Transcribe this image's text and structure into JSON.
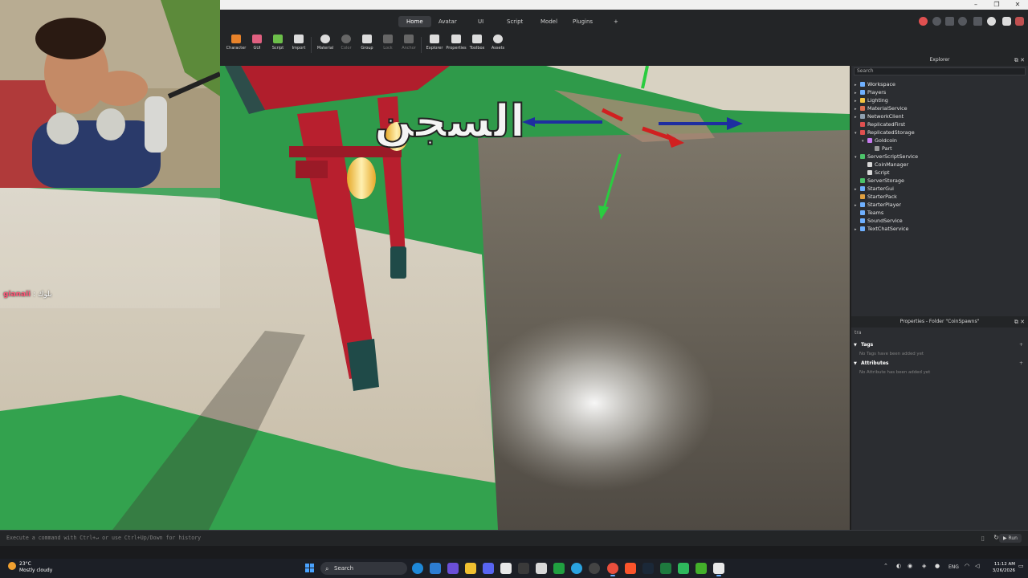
{
  "window": {
    "controls": [
      "–",
      "❐",
      "✕"
    ]
  },
  "ribbon": {
    "tabs": [
      "Home",
      "Avatar",
      "UI",
      "Script",
      "Model",
      "Plugins"
    ],
    "active_tab": "Home",
    "add_tab": "+"
  },
  "toolbar": {
    "tools": [
      "Character",
      "GUI",
      "Script",
      "Import",
      "Material",
      "Color",
      "Group",
      "Lock",
      "Anchor",
      "Explorer",
      "Properties",
      "Toolbox",
      "Assets"
    ],
    "disabled": [
      "Color",
      "Lock",
      "Anchor"
    ]
  },
  "viewport": {
    "sign_text": "السجن",
    "chat_username": "gianali",
    "chat_message": ": بلوك"
  },
  "explorer": {
    "title": "Explorer",
    "search_placeholder": "Search",
    "items": [
      {
        "label": "Workspace",
        "depth": 0,
        "arrow": "▸",
        "icon_color": "#6fb0ff"
      },
      {
        "label": "Players",
        "depth": 0,
        "arrow": "▸",
        "icon_color": "#6fb0ff"
      },
      {
        "label": "Lighting",
        "depth": 0,
        "arrow": "▸",
        "icon_color": "#f5c542"
      },
      {
        "label": "MaterialService",
        "depth": 0,
        "arrow": "▸",
        "icon_color": "#e07050"
      },
      {
        "label": "NetworkClient",
        "depth": 0,
        "arrow": "▸",
        "icon_color": "#8fa0b0"
      },
      {
        "label": "ReplicatedFirst",
        "depth": 0,
        "arrow": "",
        "icon_color": "#e05050"
      },
      {
        "label": "ReplicatedStorage",
        "depth": 0,
        "arrow": "▾",
        "icon_color": "#e05050"
      },
      {
        "label": "Goldcoin",
        "depth": 1,
        "arrow": "▾",
        "icon_color": "#c87cf0"
      },
      {
        "label": "Part",
        "depth": 2,
        "arrow": "",
        "icon_color": "#9a9a9a"
      },
      {
        "label": "ServerScriptService",
        "depth": 0,
        "arrow": "▾",
        "icon_color": "#4cc36a"
      },
      {
        "label": "CoinManager",
        "depth": 1,
        "arrow": "",
        "icon_color": "#d8d8d8"
      },
      {
        "label": "Script",
        "depth": 1,
        "arrow": "",
        "icon_color": "#d8d8d8"
      },
      {
        "label": "ServerStorage",
        "depth": 0,
        "arrow": "",
        "icon_color": "#4cc36a"
      },
      {
        "label": "StarterGui",
        "depth": 0,
        "arrow": "▸",
        "icon_color": "#6fb0ff"
      },
      {
        "label": "StarterPack",
        "depth": 0,
        "arrow": "",
        "icon_color": "#e0a040"
      },
      {
        "label": "StarterPlayer",
        "depth": 0,
        "arrow": "▸",
        "icon_color": "#6fb0ff"
      },
      {
        "label": "Teams",
        "depth": 0,
        "arrow": "",
        "icon_color": "#6fb0ff"
      },
      {
        "label": "SoundService",
        "depth": 0,
        "arrow": "",
        "icon_color": "#6fb0ff"
      },
      {
        "label": "TextChatService",
        "depth": 0,
        "arrow": "▸",
        "icon_color": "#6fb0ff"
      }
    ]
  },
  "properties": {
    "title": "Properties - Folder \"CoinSpawns\"",
    "filter_value": "tra",
    "sections": [
      {
        "name": "Tags",
        "empty_text": "No Tags have been added yet"
      },
      {
        "name": "Attributes",
        "empty_text": "No Attribute has been added yet"
      }
    ]
  },
  "command_bar": {
    "placeholder": "Execute a command with Ctrl+↵ or use Ctrl+Up/Down for history",
    "run_label": "Run"
  },
  "taskbar": {
    "temperature": "23°C",
    "weather": "Mostly cloudy",
    "search_label": "Search",
    "language": "ENG",
    "time": "11:12 AM",
    "date": "3/26/2026"
  },
  "colors": {
    "accent": "#4aa3ff",
    "ribbon_bg": "#232527",
    "panel_bg": "#2b2d31"
  }
}
